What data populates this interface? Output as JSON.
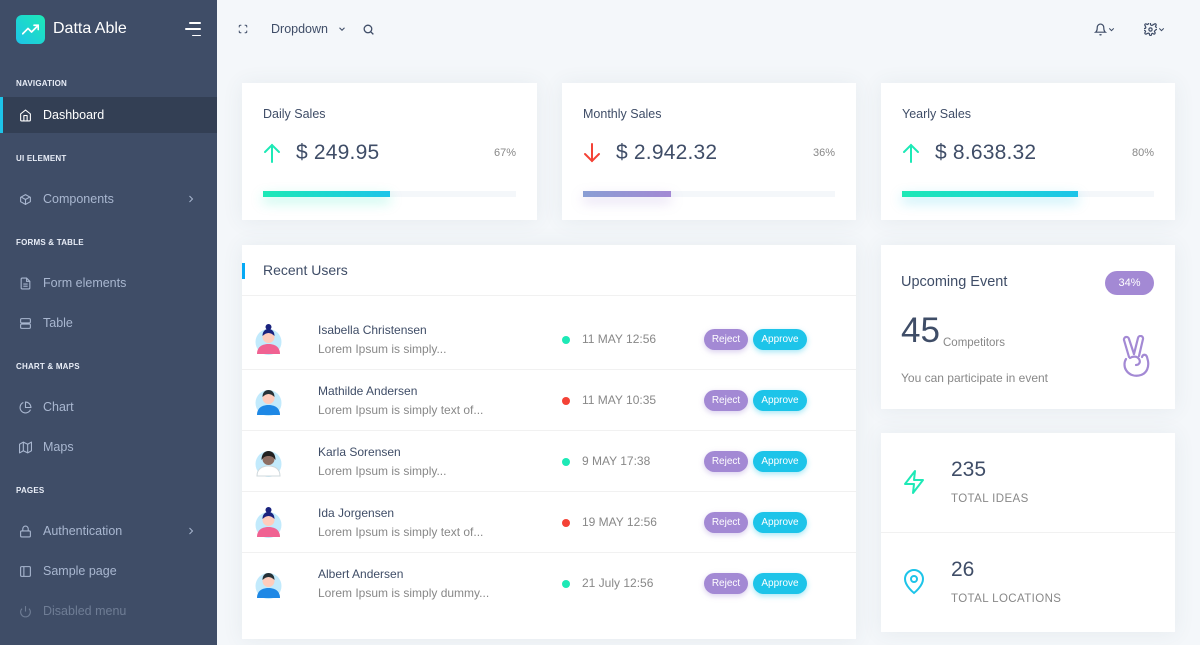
{
  "brand": {
    "name": "Datta Able"
  },
  "header": {
    "dropdown_label": "Dropdown"
  },
  "sidebar": {
    "sections": [
      {
        "caption": "NAVIGATION",
        "items": [
          {
            "label": "Dashboard",
            "icon": "home-icon",
            "active": true
          }
        ]
      },
      {
        "caption": "UI ELEMENT",
        "items": [
          {
            "label": "Components",
            "icon": "box-icon",
            "submenu": true
          }
        ]
      },
      {
        "caption": "FORMS & TABLE",
        "items": [
          {
            "label": "Form elements",
            "icon": "file-text-icon"
          },
          {
            "label": "Table",
            "icon": "server-icon"
          }
        ]
      },
      {
        "caption": "CHART & MAPS",
        "items": [
          {
            "label": "Chart",
            "icon": "pie-chart-icon"
          },
          {
            "label": "Maps",
            "icon": "map-icon"
          }
        ]
      },
      {
        "caption": "PAGES",
        "items": [
          {
            "label": "Authentication",
            "icon": "lock-icon",
            "submenu": true
          },
          {
            "label": "Sample page",
            "icon": "sidebar-icon"
          },
          {
            "label": "Disabled menu",
            "icon": "power-icon",
            "disabled": true
          }
        ]
      }
    ]
  },
  "stats": [
    {
      "title": "Daily Sales",
      "value": "$ 249.95",
      "percent": "67%",
      "progress": 0.5,
      "trend": "up",
      "color": "#1de9b6"
    },
    {
      "title": "Monthly Sales",
      "value": "$ 2.942.32",
      "percent": "36%",
      "progress": 0.35,
      "trend": "down",
      "color": "#a389d4"
    },
    {
      "title": "Yearly Sales",
      "value": "$ 8.638.32",
      "percent": "80%",
      "progress": 0.7,
      "trend": "up",
      "color": "#1dc4e9"
    }
  ],
  "recent_users": {
    "title": "Recent Users",
    "reject_label": "Reject",
    "approve_label": "Approve",
    "rows": [
      {
        "name": "Isabella Christensen",
        "desc": "Lorem Ipsum is simply...",
        "date": "11 MAY 12:56",
        "status": "green",
        "avatar": "female-avatar-icon"
      },
      {
        "name": "Mathilde Andersen",
        "desc": "Lorem Ipsum is simply text of...",
        "date": "11 MAY 10:35",
        "status": "red",
        "avatar": "male-avatar-icon"
      },
      {
        "name": "Karla Sorensen",
        "desc": "Lorem Ipsum is simply...",
        "date": "9 MAY 17:38",
        "status": "green",
        "avatar": "dark-avatar-icon"
      },
      {
        "name": "Ida Jorgensen",
        "desc": "Lorem Ipsum is simply text of...",
        "date": "19 MAY 12:56",
        "status": "red",
        "avatar": "female-avatar-icon"
      },
      {
        "name": "Albert Andersen",
        "desc": "Lorem Ipsum is simply dummy...",
        "date": "21 July 12:56",
        "status": "green",
        "avatar": "male-avatar-icon"
      }
    ]
  },
  "event": {
    "title": "Upcoming Event",
    "badge": "34%",
    "count": "45",
    "count_label": "Competitors",
    "desc": "You can participate in event"
  },
  "metrics": [
    {
      "value": "235",
      "label": "TOTAL IDEAS",
      "icon": "zap-icon"
    },
    {
      "value": "26",
      "label": "TOTAL LOCATIONS",
      "icon": "map-pin-icon"
    }
  ],
  "colors": {
    "sidebar": "#3f4d67",
    "accent": "#1dc4e9",
    "teal": "#1de9b6",
    "purple": "#a389d4",
    "green_dot": "#1de9b6",
    "red_dot": "#f44236"
  }
}
